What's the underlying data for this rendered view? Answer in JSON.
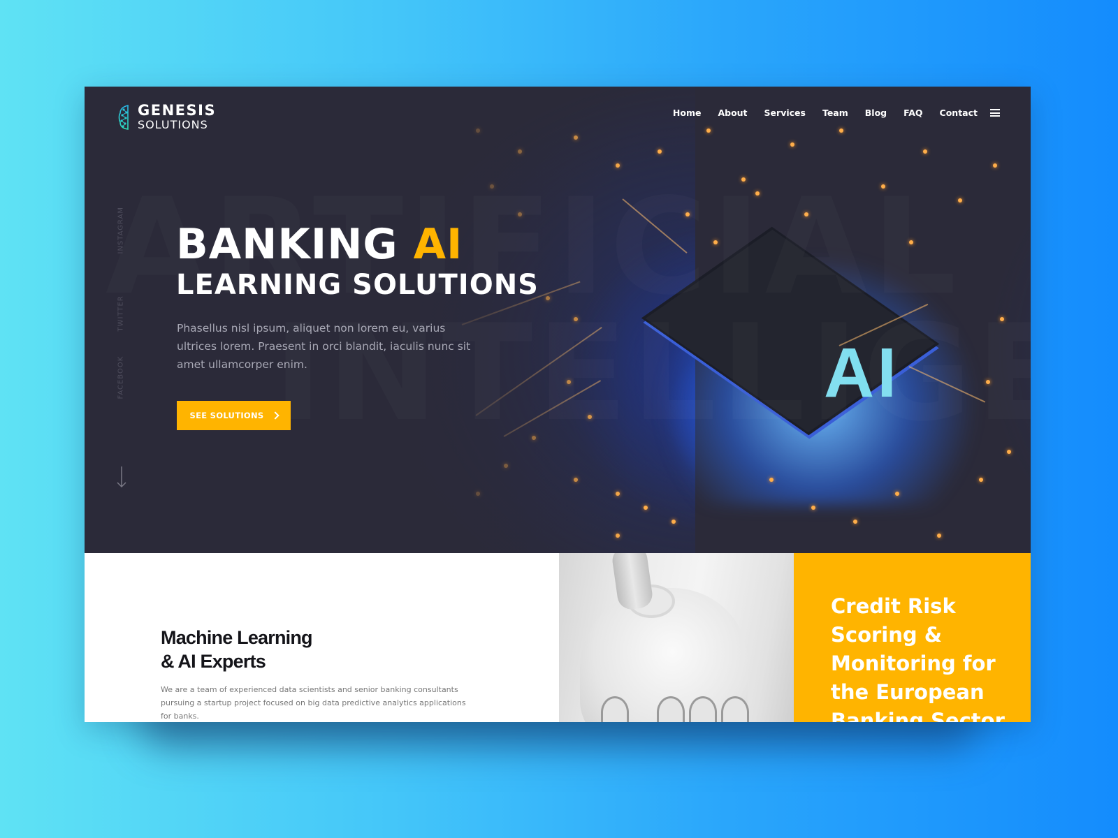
{
  "brand": {
    "name_top": "GENESIS",
    "name_bottom": "SOLUTIONS",
    "accent_color": "#ffb400",
    "logo_color": "#2ad4c6"
  },
  "nav": {
    "items": [
      {
        "label": "Home"
      },
      {
        "label": "About"
      },
      {
        "label": "Services"
      },
      {
        "label": "Team"
      },
      {
        "label": "Blog"
      },
      {
        "label": "FAQ"
      },
      {
        "label": "Contact"
      }
    ],
    "menu_icon": "hamburger-icon"
  },
  "social": {
    "items": [
      {
        "label": "INSTAGRAM"
      },
      {
        "label": "TWITTER"
      },
      {
        "label": "FACEBOOK"
      }
    ],
    "scroll_icon": "arrow-down-icon"
  },
  "hero": {
    "watermark_line1": "ARTIFICIAL",
    "watermark_line2": "INTELLIGENCE",
    "title_word1": "BANKING",
    "title_accent": "AI",
    "title_line2": "LEARNING SOLUTIONS",
    "description": "Phasellus nisl ipsum, aliquet non lorem eu, varius ultrices lorem. Praesent in orci blandit, iaculis nunc sit amet ullamcorper enim.",
    "cta_label": "SEE SOLUTIONS",
    "chip_label": "AI"
  },
  "about": {
    "title_line1": "Machine Learning",
    "title_line2": "& AI Experts",
    "description": "We are a team of experienced data scientists and senior banking consultants pursuing a startup project focused on big data predictive analytics applications for banks."
  },
  "feature_card": {
    "title": "Credit Risk Scoring & Monitoring for the European Banking Sector"
  }
}
